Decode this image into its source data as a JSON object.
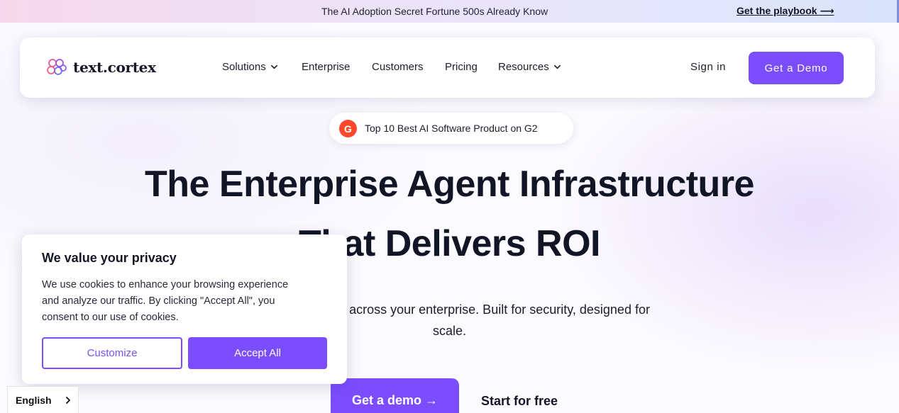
{
  "announcement": {
    "text": "The AI Adoption Secret Fortune 500s Already Know",
    "link_label": "Get the playbook ⟶"
  },
  "nav": {
    "logo_text": "text.cortex",
    "items": [
      {
        "label": "Solutions",
        "has_dropdown": true
      },
      {
        "label": "Enterprise",
        "has_dropdown": false
      },
      {
        "label": "Customers",
        "has_dropdown": false
      },
      {
        "label": "Pricing",
        "has_dropdown": false
      },
      {
        "label": "Resources",
        "has_dropdown": true
      }
    ],
    "signin_label": "Sign in",
    "demo_label": "Get a Demo"
  },
  "badge": {
    "icon_letter": "G",
    "text": "Top 10 Best AI Software Product on G2"
  },
  "hero": {
    "line1": "The Enterprise Agent Infrastructure",
    "line2": "That Delivers ROI",
    "sub_line1": "Deploy AI agents across your enterprise. Built for security, designed for",
    "sub_line2": "scale.",
    "cta_demo": "Get a demo →",
    "cta_free": "Start for free"
  },
  "cookie": {
    "title": "We value your privacy",
    "body_line1": "We use cookies to enhance your browsing experience",
    "body_line2": "and analyze our traffic. By clicking \"Accept All\", you",
    "body_line3": "consent to our use of cookies.",
    "customize_label": "Customize",
    "accept_label": "Accept All"
  },
  "language": {
    "label": "English"
  },
  "colors": {
    "accent": "#7c4dff",
    "g2_red": "#ff492c",
    "text_dark": "#111526"
  }
}
